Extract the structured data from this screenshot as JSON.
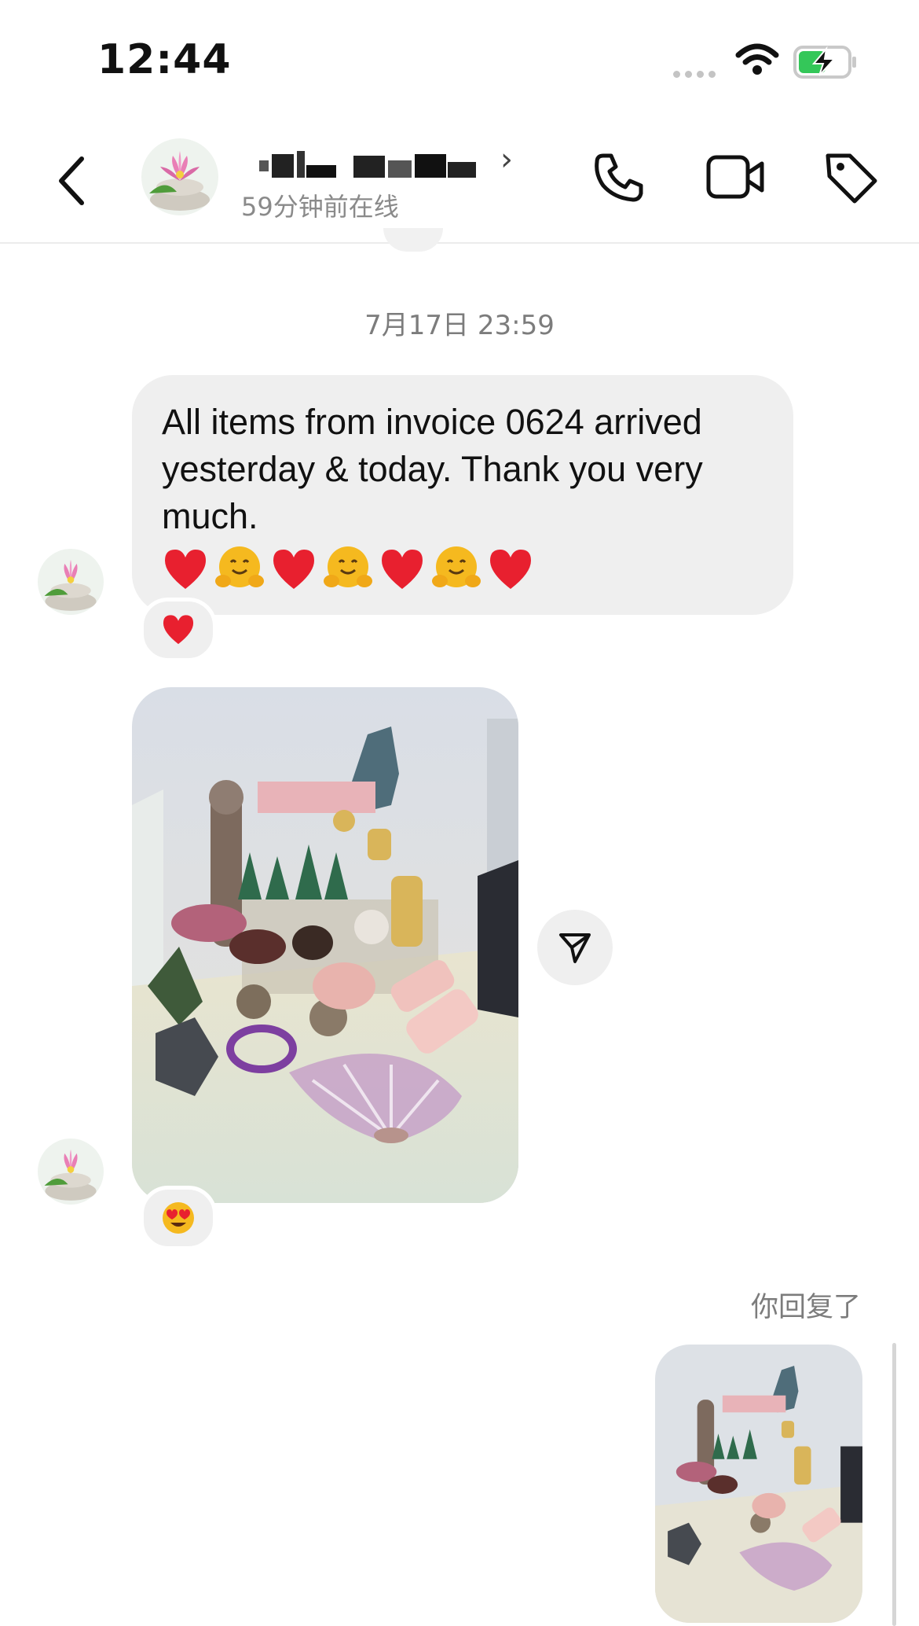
{
  "status_bar": {
    "time": "12:44",
    "icons": [
      "signal-dots-icon",
      "wifi-icon",
      "battery-charging-icon"
    ],
    "battery_color": "#34c759"
  },
  "header": {
    "contact_name": "",
    "online_status": "59分钟前在线",
    "icons": [
      "back-chevron-icon",
      "phone-icon",
      "video-camera-icon",
      "tag-icon"
    ]
  },
  "conversation": {
    "timestamp": "7月17日 23:59",
    "message_1": {
      "text": "All items from invoice 0624 arrived yesterday & today. Thank you very much.",
      "emojis": [
        "❤️",
        "🤗",
        "❤️",
        "🤗",
        "❤️",
        "🤗",
        "❤️"
      ],
      "reaction": "❤️"
    },
    "photo_1": {
      "reaction": "😍",
      "share_icon": "send-icon"
    },
    "reply_label": "你回复了"
  },
  "colors": {
    "bubble_bg": "#efefef",
    "heart": "#e8202f",
    "hug": "#f5b91f",
    "secondary_text": "#7c7c7c"
  }
}
